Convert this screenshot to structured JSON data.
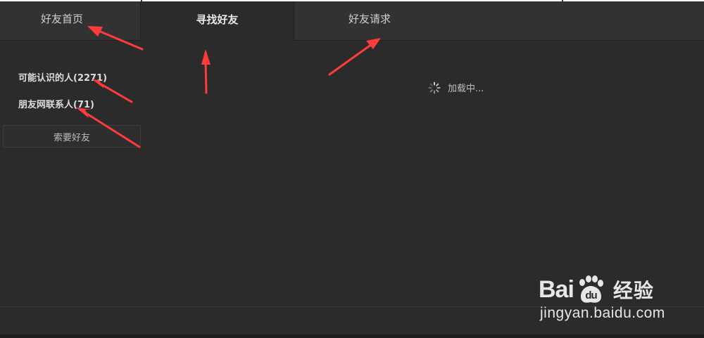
{
  "tabs": {
    "home_label": "好友首页",
    "find_label": "寻找好友",
    "requests_label": "好友请求"
  },
  "sidebar": {
    "people_you_may_know": "可能认识的人(2271)",
    "contacts": "朋友网联系人(71)",
    "request_button": "索要好友"
  },
  "main": {
    "loading_text": "加载中..."
  },
  "watermark": {
    "logo_left": "Bai",
    "logo_right": "经验",
    "url": "jingyan.baidu.com"
  },
  "colors": {
    "background": "#2b2b2b",
    "annotation_arrow": "#ff3b3b"
  }
}
